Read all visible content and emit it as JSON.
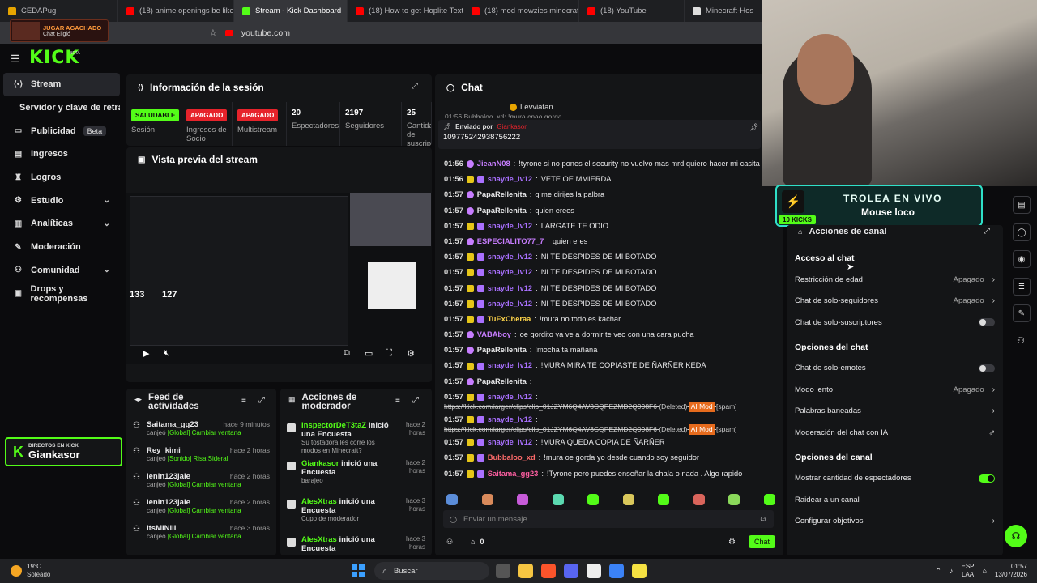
{
  "browser": {
    "tabs": [
      {
        "label": "CEDAPug",
        "color": "#e6a400"
      },
      {
        "label": "(18) anime openings be like - Y",
        "color": "#ff0000"
      },
      {
        "label": "Stream - Kick Dashboard",
        "color": "#53fc18"
      },
      {
        "label": "(18) How to get Hoplite Textur",
        "color": "#ff0000"
      },
      {
        "label": "(18) mod mowzies minecraft 1",
        "color": "#ff0000"
      },
      {
        "label": "(18) YouTube",
        "color": "#ff0000"
      },
      {
        "label": "Minecraft-Hostin",
        "color": "#dddddd"
      }
    ],
    "url": "youtube.com"
  },
  "mini_overlay": {
    "title": "JUGAR AGACHADO",
    "subtitle": "Chat Eligió"
  },
  "header": {
    "logo": "KICK",
    "beta": "BETA"
  },
  "sidebar": {
    "items": [
      {
        "label": "Stream",
        "icon": "stream-icon"
      },
      {
        "label": "Servidor y clave de retransmisión"
      },
      {
        "label": "Publicidad",
        "icon": "ad-icon",
        "badge": "Beta"
      },
      {
        "label": "Ingresos",
        "icon": "chart-icon"
      },
      {
        "label": "Logros",
        "icon": "trophy-icon"
      },
      {
        "label": "Estudio",
        "icon": "studio-icon",
        "chev": "⌄"
      },
      {
        "label": "Analíticas",
        "icon": "analytics-icon",
        "chev": "⌄"
      },
      {
        "label": "Moderación",
        "icon": "wrench-icon"
      },
      {
        "label": "Comunidad",
        "icon": "community-icon",
        "chev": "⌄"
      },
      {
        "label": "Drops y recompensas",
        "icon": "gift-icon"
      }
    ]
  },
  "live_badge": {
    "top": "DIRECTOS EN KICK",
    "name": "Giankasor"
  },
  "session": {
    "title": "Información de la sesión",
    "stats": [
      {
        "chip": "SALUDABLE",
        "chip_type": "green",
        "label": "Sesión"
      },
      {
        "chip": "APAGADO",
        "chip_type": "red",
        "label": "Ingresos de Socio"
      },
      {
        "chip": "APAGADO",
        "chip_type": "red",
        "label": "Multistream"
      },
      {
        "value": "20",
        "label": "Espectadores"
      },
      {
        "value": "2197",
        "label": "Seguidores"
      },
      {
        "value": "25",
        "label": "Cantidad de suscriptores"
      }
    ]
  },
  "preview": {
    "title": "Vista previa del stream",
    "counters": [
      "133",
      "127"
    ]
  },
  "feed": {
    "title": "Feed de actividades",
    "items": [
      {
        "user": "Saitama_gg23",
        "time": "hace 9 minutos",
        "action": "canjeó",
        "reward": "[Global] Cambiar ventana"
      },
      {
        "user": "Rey_kimi",
        "time": "hace 2 horas",
        "action": "canjeó",
        "reward": "[Sonido] Risa Sideral"
      },
      {
        "user": "lenin123jale",
        "time": "hace 2 horas",
        "action": "canjeó",
        "reward": "[Global] Cambiar ventana"
      },
      {
        "user": "lenin123jale",
        "time": "hace 2 horas",
        "action": "canjeó",
        "reward": "[Global] Cambiar ventana"
      },
      {
        "user": "ItsMINIII",
        "time": "hace 3 horas",
        "action": "canjeó",
        "reward": "[Global] Cambiar ventana"
      }
    ]
  },
  "modactions": {
    "title": "Acciones de moderador",
    "items": [
      {
        "user": "InspectorDeT3taZ",
        "text": "inició una Encuesta",
        "sub": "Su tostadora les corre los modos en Minecraft?",
        "time": "hace 2 horas"
      },
      {
        "user": "Giankasor",
        "text": "inició una Encuesta",
        "sub": "barajeo",
        "time": "hace 2 horas"
      },
      {
        "user": "AlesXtras",
        "text": "inició una Encuesta",
        "sub": "Cupo de moderador",
        "time": "hace 3 horas"
      },
      {
        "user": "AlesXtras",
        "text": "inició una Encuesta",
        "sub": "",
        "time": "hace 3 horas"
      }
    ]
  },
  "chat": {
    "title": "Chat",
    "top_user": "Levviatan",
    "top_partial": "01:56  Bubbaloo_xd: !mura cnao gorga",
    "pinned_by": "Enviado por",
    "pinned_user": "Giankasor",
    "pinned_text": "109775242938756222",
    "messages": [
      {
        "t": "01:56",
        "u": "JieanN08",
        "c": "#c77dff",
        "m": "!tyrone si no pones el security no vuelvo mas mrd quiero hacer mi casita"
      },
      {
        "t": "01:56",
        "u": "snayde_lv12",
        "c": "#a970ff",
        "m": "VETE OE MMIERDA",
        "sub": true
      },
      {
        "t": "01:57",
        "u": "PapaRellenita",
        "c": "#e8e8ea",
        "m": "q me dirijes la palbra"
      },
      {
        "t": "01:57",
        "u": "PapaRellenita",
        "c": "#e8e8ea",
        "m": "quien erees"
      },
      {
        "t": "01:57",
        "u": "snayde_lv12",
        "c": "#a970ff",
        "m": "LARGATE TE ODIO",
        "sub": true
      },
      {
        "t": "01:57",
        "u": "ESPECIALITO77_7",
        "c": "#c77dff",
        "m": "quien eres"
      },
      {
        "t": "01:57",
        "u": "snayde_lv12",
        "c": "#a970ff",
        "m": "NI TE DESPIDES DE MI BOTADO",
        "sub": true
      },
      {
        "t": "01:57",
        "u": "snayde_lv12",
        "c": "#a970ff",
        "m": "NI TE DESPIDES DE MI BOTADO",
        "sub": true
      },
      {
        "t": "01:57",
        "u": "snayde_lv12",
        "c": "#a970ff",
        "m": "NI TE DESPIDES DE MI BOTADO",
        "sub": true
      },
      {
        "t": "01:57",
        "u": "snayde_lv12",
        "c": "#a970ff",
        "m": "NI TE DESPIDES DE MI BOTADO",
        "sub": true
      },
      {
        "t": "01:57",
        "u": "TuExCheraa",
        "c": "#ffd54a",
        "m": "!mura no todo es kachar",
        "sub": true
      },
      {
        "t": "01:57",
        "u": "VABAboy",
        "c": "#c77dff",
        "m": "oe gordito ya ve a dormir te veo con una cara pucha"
      },
      {
        "t": "01:57",
        "u": "PapaRellenita",
        "c": "#e8e8ea",
        "m": "!mocha ta mañana"
      },
      {
        "t": "01:57",
        "u": "snayde_lv12",
        "c": "#a970ff",
        "m": "!MURA MIRA TE COPIASTE DE ÑARÑER KEDA",
        "sub": true
      },
      {
        "t": "01:57",
        "u": "PapaRellenita",
        "c": "#e8e8ea",
        "m": ""
      }
    ],
    "deleted": [
      {
        "t": "01:57",
        "u": "snayde_lv12",
        "link": "https://kick.com/iarger/clips/clip_01JZYM6Q4AV3CQPEZMD2Q998F6",
        "tag": "(Deleted)",
        "mod": "AI Mod",
        "flag": "[spam]"
      },
      {
        "t": "01:57",
        "u": "snayde_lv12",
        "link": "https://kick.com/iarger/clips/clip_01JZYM6Q4AV3CQPEZMD2Q998F6",
        "tag": "(Deleted)",
        "mod": "AI Mod",
        "flag": "[spam]"
      }
    ],
    "after": [
      {
        "t": "01:57",
        "u": "snayde_lv12",
        "c": "#a970ff",
        "m": "!MURA QUEDA COPIA DE ÑARÑER",
        "sub": true
      },
      {
        "t": "01:57",
        "u": "Bubbaloo_xd",
        "c": "#ff6b6b",
        "m": "!mura oe gorda yo desde cuando soy seguidor",
        "sub": true
      },
      {
        "t": "01:57",
        "u": "Saitama_gg23",
        "c": "#ff5fa2",
        "m": "!Tyrone pero puedes enseñar la chala o nada . Algo rapido",
        "sub": true
      }
    ],
    "input_placeholder": "Enviar un mensaje",
    "count": "0",
    "send": "Chat"
  },
  "overlay_alert": {
    "title": "TROLEA EN VIVO",
    "kicks": "10 KICKS",
    "sub": "Mouse loco"
  },
  "channel_actions": {
    "title": "Acciones de canal",
    "sections": [
      {
        "title": "Acceso al chat",
        "rows": [
          {
            "label": "Restricción de edad",
            "value": "Apagado",
            "ctrl": "chevron"
          },
          {
            "label": "Chat de solo-seguidores",
            "value": "Apagado",
            "ctrl": "chevron"
          },
          {
            "label": "Chat de solo-suscriptores",
            "value": "",
            "ctrl": "toggle-off"
          }
        ]
      },
      {
        "title": "Opciones del chat",
        "rows": [
          {
            "label": "Chat de solo-emotes",
            "value": "",
            "ctrl": "toggle-off"
          },
          {
            "label": "Modo lento",
            "value": "Apagado",
            "ctrl": "chevron"
          },
          {
            "label": "Palabras baneadas",
            "value": "",
            "ctrl": "chevron"
          },
          {
            "label": "Moderación del chat con IA",
            "value": "",
            "ctrl": "external"
          }
        ]
      },
      {
        "title": "Opciones del canal",
        "rows": [
          {
            "label": "Mostrar cantidad de espectadores",
            "value": "",
            "ctrl": "toggle-on"
          },
          {
            "label": "Raidear a un canal",
            "value": "",
            "ctrl": "none"
          },
          {
            "label": "Configurar objetivos",
            "value": "",
            "ctrl": "chevron"
          }
        ]
      }
    ]
  },
  "taskbar": {
    "weather_temp": "19°C",
    "weather_desc": "Soleado",
    "search": "Buscar",
    "lang1": "ESP",
    "lang2": "LAA",
    "time": "01:57",
    "date": "13/07/2026"
  },
  "colors": {
    "accent": "#53fc18",
    "red": "#e6232b",
    "panel": "#141517",
    "bg": "#0b0b0d"
  }
}
